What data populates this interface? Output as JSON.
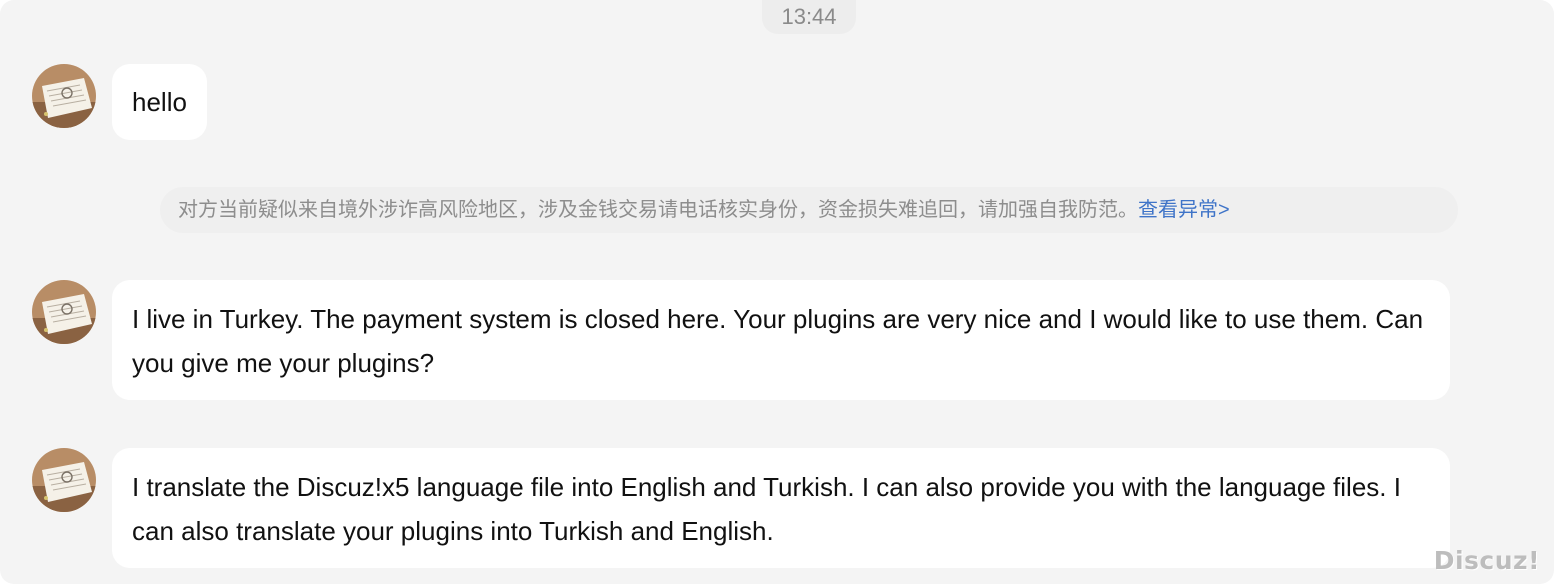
{
  "header": {
    "timestamp": "13:44"
  },
  "colors": {
    "window_bg": "#f4f4f4",
    "bubble_bg": "#ffffff",
    "notice_bg": "#efefef",
    "notice_text": "#8d8d8d",
    "link": "#3f74c8"
  },
  "messages": [
    {
      "sender": "contact",
      "avatar_icon": "user-avatar-icon",
      "text": "hello"
    },
    {
      "sender": "contact",
      "avatar_icon": "user-avatar-icon",
      "text": "I live in Turkey. The payment system is closed here. Your plugins are very nice and I would like to use them. Can you give me your plugins?"
    },
    {
      "sender": "contact",
      "avatar_icon": "user-avatar-icon",
      "text": "I translate the Discuz!x5 language file into English and Turkish. I can also provide you with the language files. I can also translate your plugins into Turkish and English."
    }
  ],
  "risk_notice": {
    "text": "对方当前疑似来自境外涉诈高风险地区，涉及金钱交易请电话核实身份，资金损失难追回，请加强自我防范。",
    "link_text": "查看异常>"
  },
  "watermark": "Discuz!"
}
